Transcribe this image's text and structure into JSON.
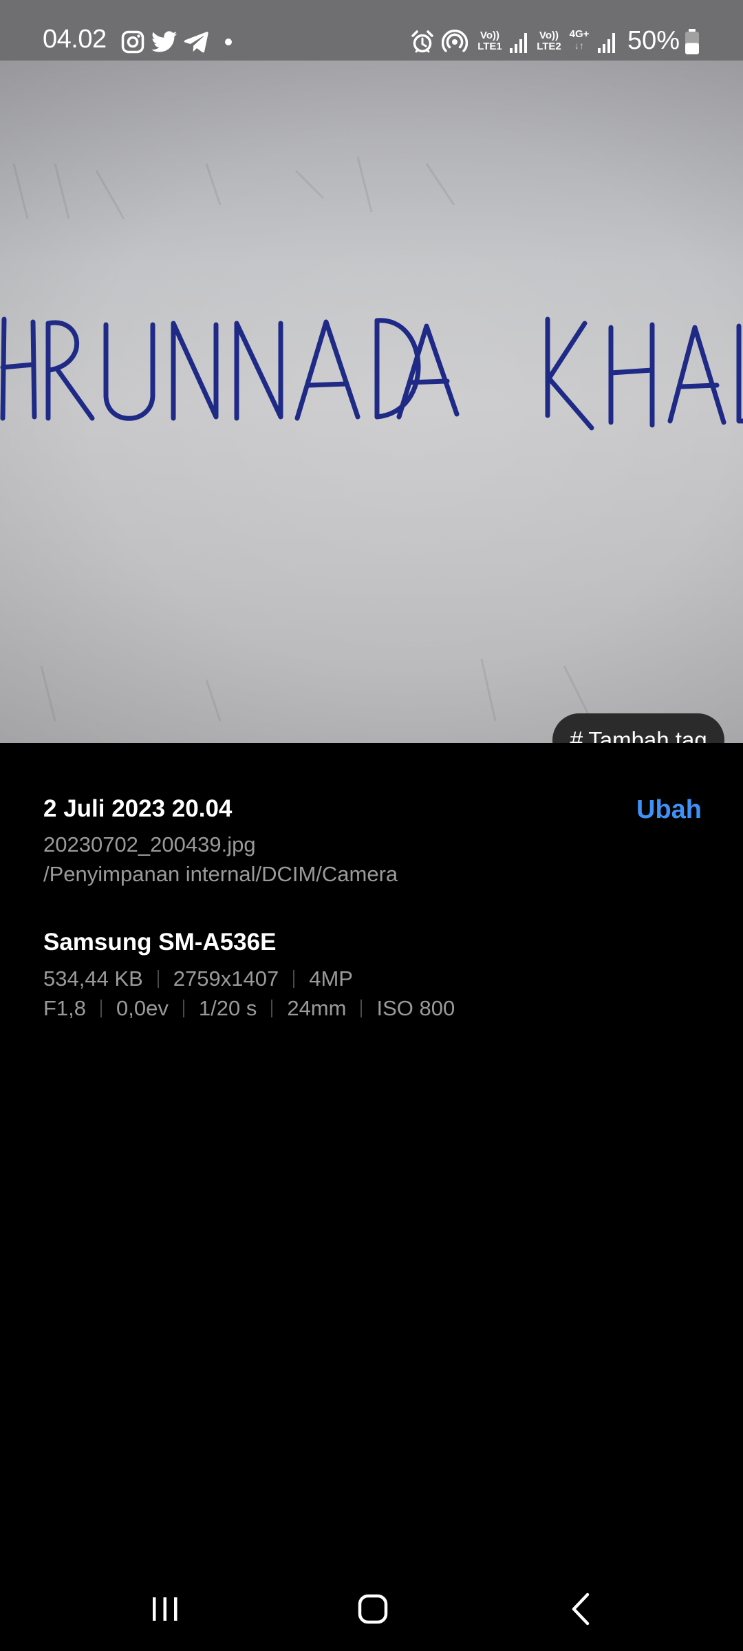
{
  "status_bar": {
    "time": "04.02",
    "notification_icons": [
      "instagram-icon",
      "twitter-icon",
      "telegram-icon",
      "dot-icon"
    ],
    "system_icons": [
      "alarm-icon",
      "hotspot-icon",
      "volte-sim1-icon",
      "signal-sim1-icon",
      "volte-sim2-icon",
      "network-4g-plus-icon",
      "signal-sim2-icon"
    ],
    "volte1_top": "Vo))",
    "volte1_bottom": "LTE1",
    "volte2_top": "Vo))",
    "volte2_bottom": "LTE2",
    "network_type": "4G+",
    "battery_percent": "50%",
    "battery_level": 0.5
  },
  "photo": {
    "handwritten_text": "HRUNNADA KHAL",
    "ink_color": "#1f2a86",
    "tag_button_symbol": "#",
    "tag_button_label": "Tambah tag"
  },
  "details": {
    "date_time": "2 Juli 2023 20.04",
    "edit_label": "Ubah",
    "file_name": "20230702_200439.jpg",
    "file_path": "/Penyimpanan internal/DCIM/Camera",
    "device": "Samsung SM-A536E",
    "file_size": "534,44 KB",
    "resolution": "2759x1407",
    "megapixels": "4MP",
    "aperture": "F1,8",
    "exposure_value": "0,0ev",
    "shutter_speed": "1/20 s",
    "focal_length": "24mm",
    "iso": "ISO 800"
  },
  "colors": {
    "accent": "#3e91f7",
    "status_bar_bg": "#6f6f71",
    "secondary_text": "#9a9a9a"
  },
  "nav_bar": {
    "buttons": [
      "recents-icon",
      "home-icon",
      "back-icon"
    ]
  }
}
